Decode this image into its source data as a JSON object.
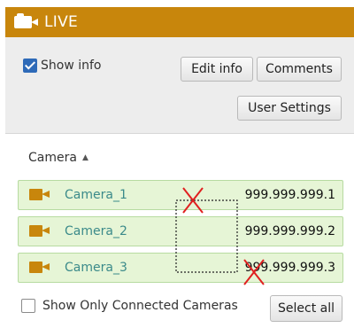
{
  "window": {
    "title": "LIVE",
    "accent_color": "#c8860c"
  },
  "controls": {
    "show_info_label": "Show info",
    "show_info_checked": true,
    "edit_info_label": "Edit info",
    "comments_label": "Comments",
    "user_settings_label": "User Settings"
  },
  "list_header": {
    "label": "Camera",
    "sort_direction": "ascending"
  },
  "cameras": [
    {
      "name": "Camera_1",
      "ip": "999.999.999.1"
    },
    {
      "name": "Camera_2",
      "ip": "999.999.999.2"
    },
    {
      "name": "Camera_3",
      "ip": "999.999.999.3"
    }
  ],
  "footer": {
    "show_connected_label": "Show Only Connected Cameras",
    "show_connected_checked": false,
    "select_all_label": "Select all"
  }
}
